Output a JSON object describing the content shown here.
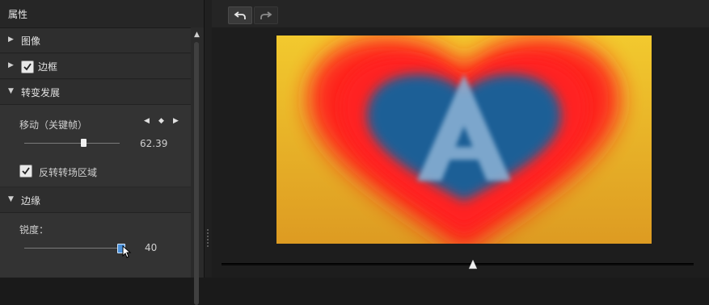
{
  "panel": {
    "title": "属性"
  },
  "sections": {
    "image": {
      "label": "图像",
      "expanded": false
    },
    "border": {
      "label": "边框",
      "expanded": false,
      "checked": true
    },
    "transition": {
      "label": "转变发展",
      "expanded": true,
      "move_label": "移动（关键帧）",
      "move_value": "62.39",
      "move_level": 0.62,
      "reverse_label": "反转转场区域",
      "reverse_checked": true
    },
    "edge": {
      "label": "边缘",
      "expanded": true,
      "sharpness_label": "锐度：",
      "sharpness_value": "40",
      "sharpness_level": 1.0
    }
  },
  "keyframe_nav": {
    "prev": "◀",
    "diamond": "◆",
    "next": "▶"
  },
  "toolbar": {
    "undo_icon": "undo-icon",
    "redo_icon": "redo-icon"
  },
  "preview": {
    "colors": {
      "background": "#e0a428",
      "heart": "#ff1a1a",
      "inner": "#1c5e96",
      "letter": "#8db3d6"
    }
  },
  "timeline": {
    "position": 0.53
  }
}
